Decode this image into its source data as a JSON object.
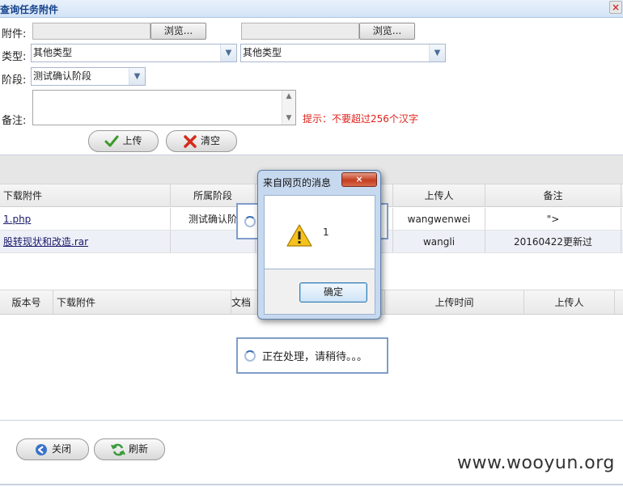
{
  "window": {
    "title": "查询任务附件",
    "close_glyph": "×"
  },
  "form": {
    "attachment_label": "附件:",
    "browse_label": "浏览...",
    "type_label": "类型:",
    "type_value_1": "其他类型",
    "type_value_2": "其他类型",
    "stage_label": "阶段:",
    "stage_value": "测试确认阶段",
    "remark_label": "备注:",
    "hint": "提示：不要超过256个汉字",
    "upload_button": "上传",
    "clear_button": "清空"
  },
  "attachments_table": {
    "columns": [
      "下载附件",
      "所属阶段",
      "",
      "上传人",
      "备注"
    ],
    "rows": [
      {
        "file": "1.php",
        "stage": "测试确认阶",
        "uploader": "wangwenwei",
        "remark": "\">"
      },
      {
        "file": "股转现状和改造.rar",
        "stage": "",
        "uploader": "wangli",
        "remark": "20160422更新过"
      }
    ]
  },
  "versions_table": {
    "columns": [
      "版本号",
      "下载附件",
      "文档",
      "上传时间",
      "上传人"
    ]
  },
  "loading": {
    "text": "正在处理，请稍待。。。"
  },
  "dialog": {
    "title": "来自网页的消息",
    "close_glyph": "×",
    "message": "1",
    "ok_label": "确定"
  },
  "footer": {
    "close_button": "关闭",
    "refresh_button": "刷新"
  },
  "watermark": "www.wooyun.org",
  "colors": {
    "hint_red": "#e0201a",
    "title_blue": "#15428b",
    "link_dark": "#1a1a6a"
  }
}
